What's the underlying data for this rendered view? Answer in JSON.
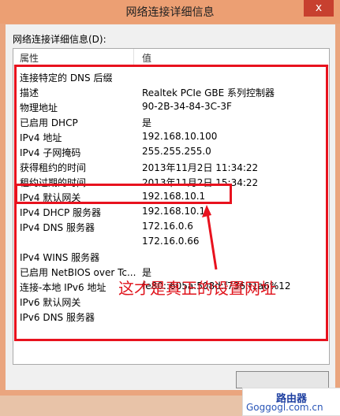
{
  "window": {
    "title": "网络连接详细信息",
    "close_glyph": "x"
  },
  "details": {
    "group_label": "网络连接详细信息(D):",
    "columns": [
      "属性",
      "值"
    ],
    "rows": [
      {
        "prop": "连接特定的 DNS 后缀",
        "val": ""
      },
      {
        "prop": "描述",
        "val": "Realtek PCIe GBE 系列控制器"
      },
      {
        "prop": "物理地址",
        "val": "90-2B-34-84-3C-3F"
      },
      {
        "prop": "已启用 DHCP",
        "val": "是"
      },
      {
        "prop": "IPv4 地址",
        "val": "192.168.10.100"
      },
      {
        "prop": "IPv4 子网掩码",
        "val": "255.255.255.0"
      },
      {
        "prop": "获得租约的时间",
        "val": "2013年11月2日 11:34:22"
      },
      {
        "prop": "租约过期的时间",
        "val": "2013年11月2日 15:34:22"
      },
      {
        "prop": "IPv4 默认网关",
        "val": "192.168.10.1"
      },
      {
        "prop": "IPv4 DHCP 服务器",
        "val": "192.168.10.1"
      },
      {
        "prop": "IPv4 DNS 服务器",
        "val": "172.16.0.6"
      },
      {
        "prop": "",
        "val": "172.16.0.66"
      },
      {
        "prop": "IPv4 WINS 服务器",
        "val": ""
      },
      {
        "prop": "已启用 NetBIOS over Tc...",
        "val": "是"
      },
      {
        "prop": "连接-本地 IPv6 地址",
        "val": "fe80::605a:508d:f736:f1a6%12"
      },
      {
        "prop": "IPv6 默认网关",
        "val": ""
      },
      {
        "prop": "IPv6 DNS 服务器",
        "val": ""
      }
    ]
  },
  "annotation": {
    "text": "这才是真正的设置网址",
    "color": "#e0141c"
  },
  "watermark": {
    "line1": "路由器",
    "line2": "Goggogl.com.cn"
  },
  "colors": {
    "highlight": "#e8121e",
    "titlebar": "#ec9f73",
    "close": "#c7402f"
  }
}
